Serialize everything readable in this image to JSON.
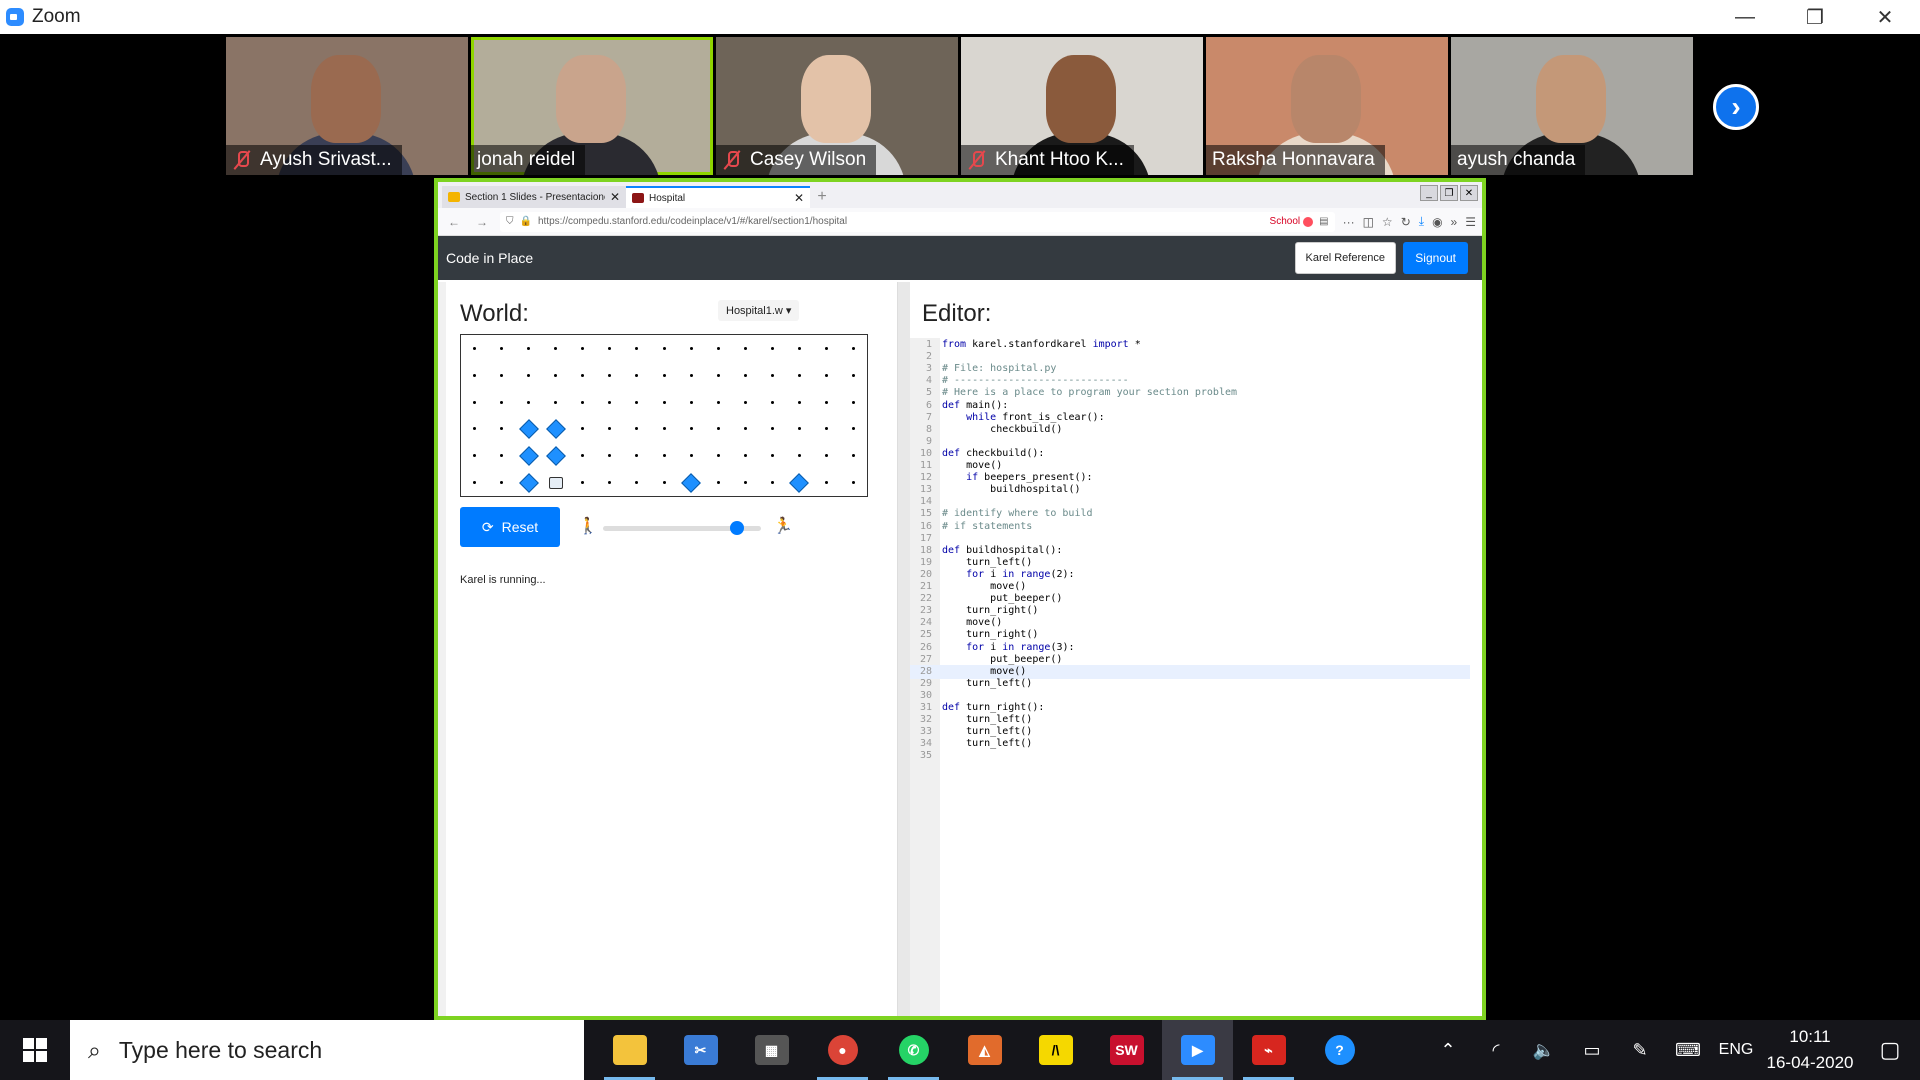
{
  "zoom": {
    "title": "Zoom",
    "minimize": "—",
    "restore": "❐",
    "close": "✕",
    "next_arrow": "›"
  },
  "participants": [
    {
      "name": "Ayush Srivast...",
      "muted": true
    },
    {
      "name": "jonah reidel",
      "muted": false
    },
    {
      "name": "Casey Wilson",
      "muted": true
    },
    {
      "name": "Khant Htoo K...",
      "muted": true
    },
    {
      "name": "Raksha Honnavara",
      "muted": false
    },
    {
      "name": "ayush chanda",
      "muted": false
    }
  ],
  "browser": {
    "tabs": [
      {
        "label": "Section 1 Slides - Presentacione",
        "close": "✕"
      },
      {
        "label": "Hospital",
        "close": "✕"
      }
    ],
    "newtab": "+",
    "url": "https://compedu.stanford.edu/codeinplace/v1/#/karel/section1/hospital",
    "school_label": "School",
    "toolbar_more": "···"
  },
  "app": {
    "title": "Code in Place",
    "karel_reference": "Karel Reference",
    "signout": "Signout"
  },
  "world": {
    "title": "World:",
    "selected_world": "Hospital1.w",
    "reset_label": "Reset",
    "status": "Karel is running...",
    "speed_fraction": 0.85,
    "cols": 15,
    "rows": 6
  },
  "editor": {
    "title": "Editor:",
    "lines": [
      "from karel.stanfordkarel import *",
      "",
      "# File: hospital.py",
      "# -----------------------------",
      "# Here is a place to program your section problem",
      "def main():",
      "    while front_is_clear():",
      "        checkbuild()",
      "",
      "def checkbuild():",
      "    move()",
      "    if beepers_present():",
      "        buildhospital()",
      "",
      "# identify where to build",
      "# if statements",
      "",
      "def buildhospital():",
      "    turn_left()",
      "    for i in range(2):",
      "        move()",
      "        put_beeper()",
      "    turn_right()",
      "    move()",
      "    turn_right()",
      "    for i in range(3):",
      "        put_beeper()",
      "        move()",
      "    turn_left()",
      "",
      "def turn_right():",
      "    turn_left()",
      "    turn_left()",
      "    turn_left()",
      ""
    ],
    "highlight_line": 28
  },
  "taskbar": {
    "search_placeholder": "Type here to search",
    "language": "ENG",
    "time": "10:11",
    "date": "16-04-2020"
  }
}
